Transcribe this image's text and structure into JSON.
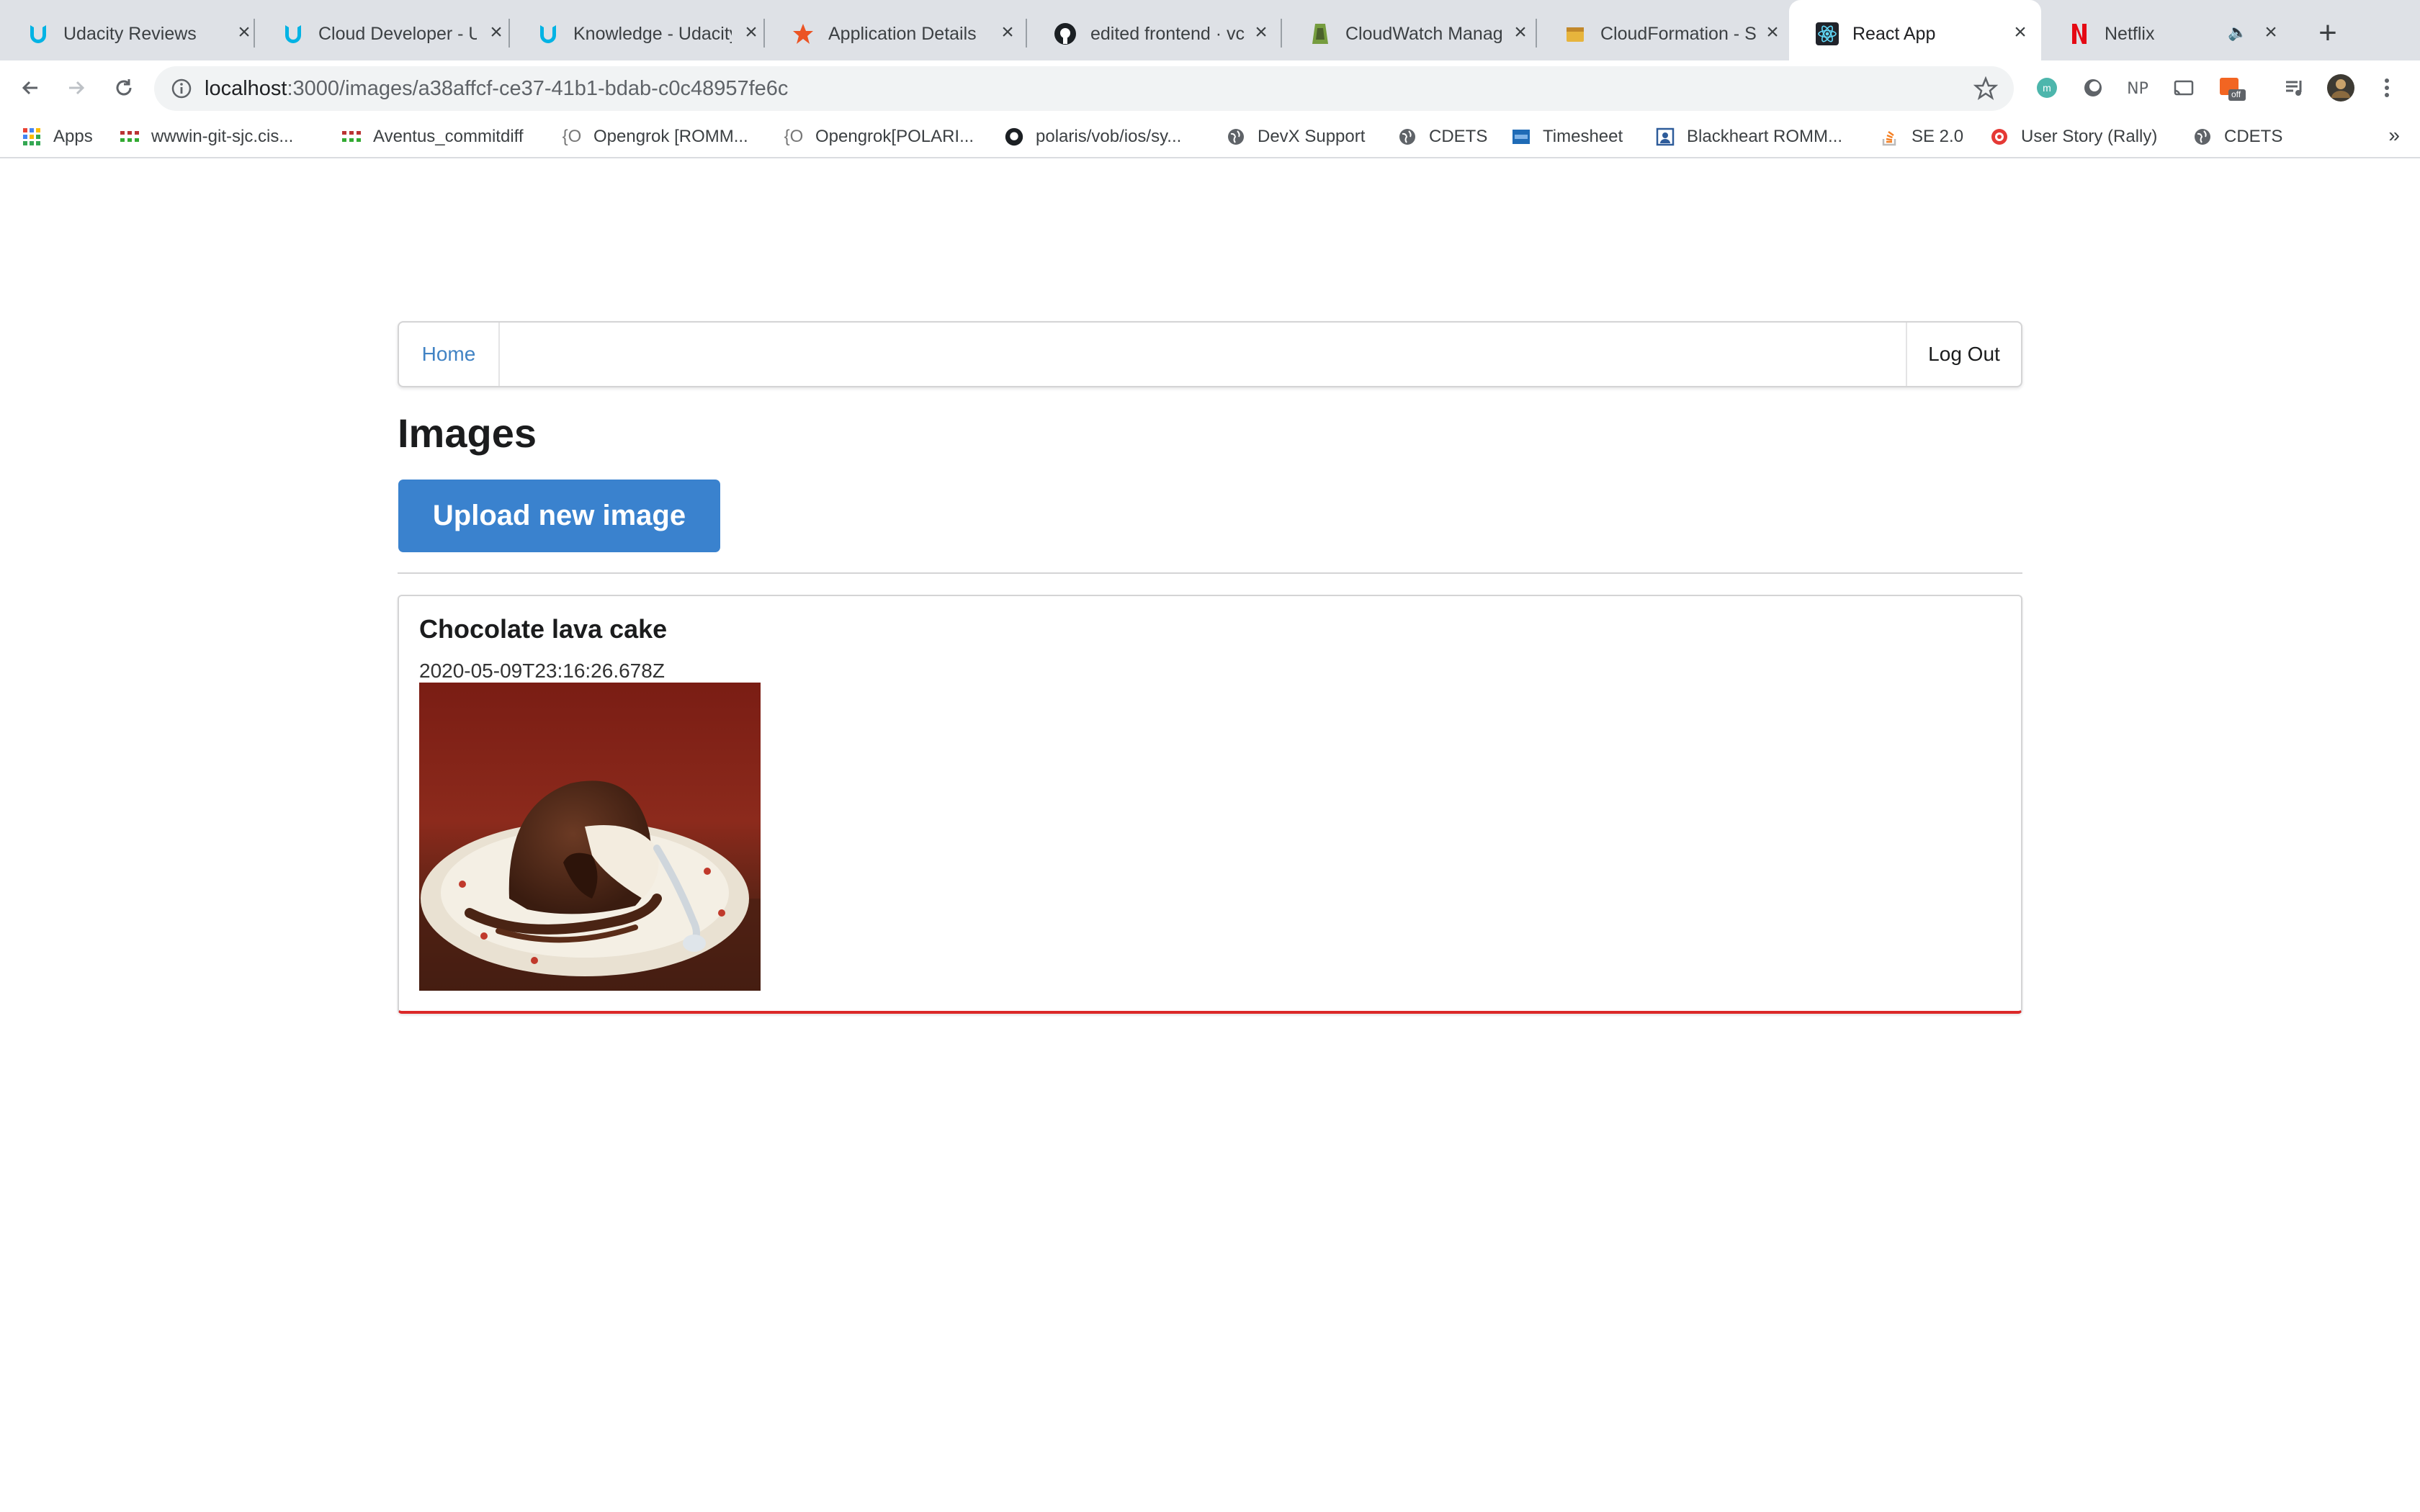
{
  "browser": {
    "tabs": [
      {
        "title": "Udacity Reviews",
        "icon": "udacity-icon"
      },
      {
        "title": "Cloud Developer - U",
        "icon": "udacity-icon"
      },
      {
        "title": "Knowledge - Udacity",
        "icon": "udacity-icon"
      },
      {
        "title": "Application Details",
        "icon": "auth0-icon"
      },
      {
        "title": "edited frontend · vc",
        "icon": "github-icon"
      },
      {
        "title": "CloudWatch Manag",
        "icon": "cloudwatch-icon"
      },
      {
        "title": "CloudFormation - S",
        "icon": "cloudformation-icon"
      },
      {
        "title": "React App",
        "icon": "react-icon",
        "active": true
      },
      {
        "title": "Netflix",
        "icon": "netflix-icon",
        "audio": true
      }
    ],
    "url_host": "localhost",
    "url_path": ":3000/images/a38affcf-ce37-41b1-bdab-c0c48957fe6c",
    "bookmarks": [
      {
        "label": "Apps"
      },
      {
        "label": "wwwin-git-sjc.cis..."
      },
      {
        "label": "Aventus_commitdiff"
      },
      {
        "label": "Opengrok [ROMM..."
      },
      {
        "label": "Opengrok[POLARI..."
      },
      {
        "label": "polaris/vob/ios/sy..."
      },
      {
        "label": "DevX Support"
      },
      {
        "label": "CDETS"
      },
      {
        "label": "Timesheet"
      },
      {
        "label": "Blackheart ROMM..."
      },
      {
        "label": "SE 2.0"
      },
      {
        "label": "User Story (Rally)"
      },
      {
        "label": "CDETS"
      }
    ],
    "more": "»",
    "ext_badge": "off"
  },
  "menu": {
    "home": "Home",
    "logout": "Log Out"
  },
  "page": {
    "heading": "Images",
    "upload_button": "Upload new image"
  },
  "image_card": {
    "title": "Chocolate lava cake",
    "timestamp": "2020-05-09T23:16:26.678Z"
  },
  "colors": {
    "primary_button": "#3a82ce",
    "link": "#4183c4",
    "card_accent": "#db2828"
  }
}
